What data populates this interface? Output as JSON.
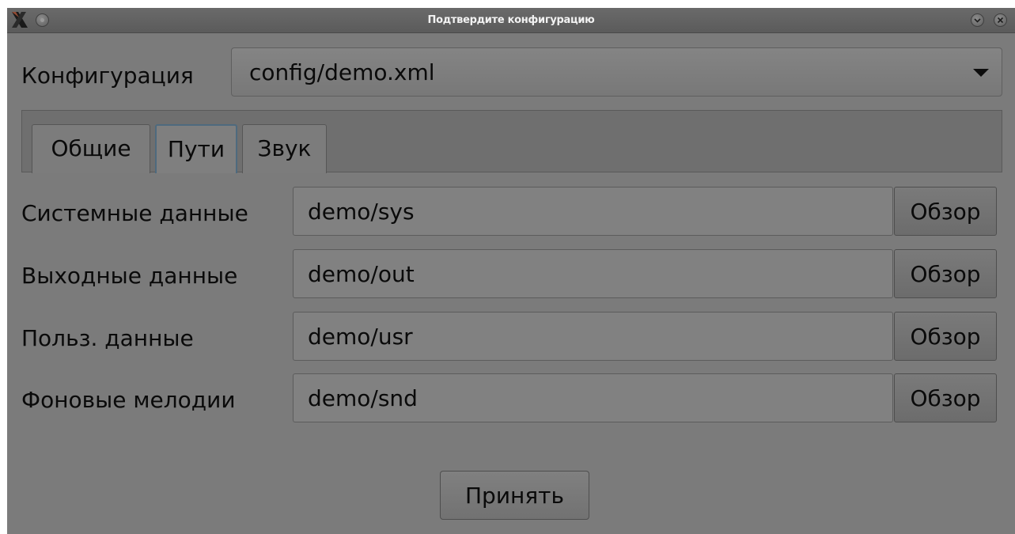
{
  "window": {
    "title": "Подтвердите конфигурацию",
    "icons": [
      "app-x-icon",
      "window-menu-icon",
      "minimize-icon",
      "close-icon"
    ]
  },
  "config": {
    "label": "Конфигурация",
    "selected": "config/demo.xml"
  },
  "tabs": [
    {
      "label": "Общие",
      "active": false
    },
    {
      "label": "Пути",
      "active": true
    },
    {
      "label": "Звук",
      "active": false
    }
  ],
  "paths": [
    {
      "label": "Системные данные",
      "value": "demo/sys",
      "browse_label": "Обзор"
    },
    {
      "label": "Выходные данные",
      "value": "demo/out",
      "browse_label": "Обзор"
    },
    {
      "label": "Польз. данные",
      "value": "demo/usr",
      "browse_label": "Обзор"
    },
    {
      "label": "Фоновые мелодии",
      "value": "demo/snd",
      "browse_label": "Обзор"
    }
  ],
  "accept_label": "Принять"
}
